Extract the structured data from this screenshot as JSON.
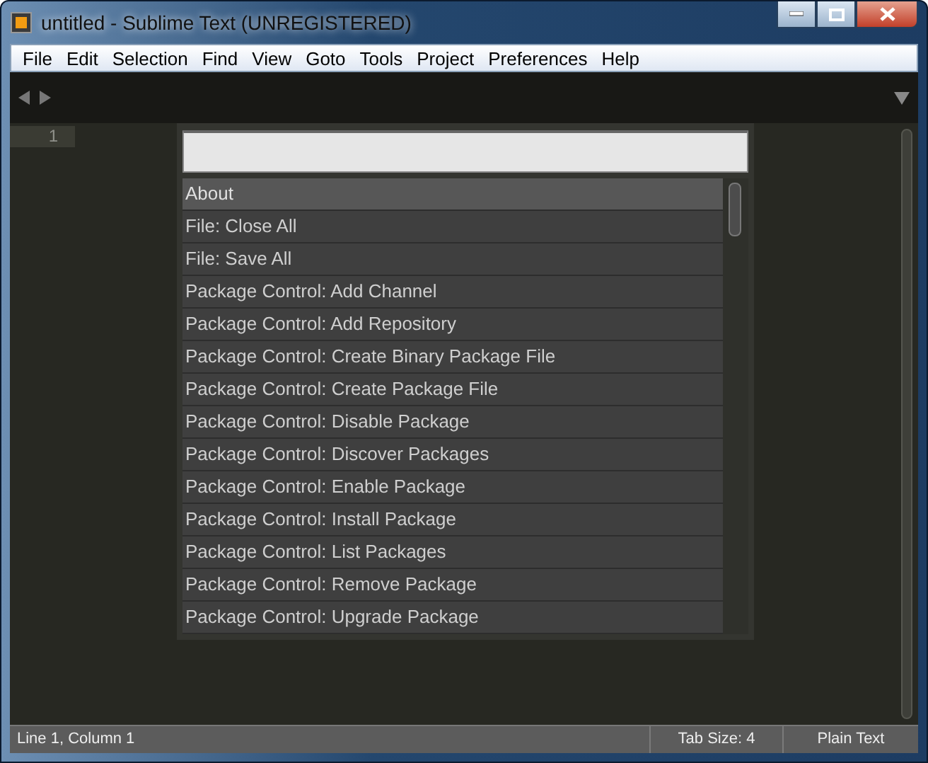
{
  "window": {
    "title": "untitled - Sublime Text (UNREGISTERED)"
  },
  "menu": [
    "File",
    "Edit",
    "Selection",
    "Find",
    "View",
    "Goto",
    "Tools",
    "Project",
    "Preferences",
    "Help"
  ],
  "editor": {
    "line_numbers": [
      "1"
    ]
  },
  "palette": {
    "items": [
      {
        "label": "About",
        "selected": true
      },
      {
        "label": "File: Close All",
        "selected": false
      },
      {
        "label": "File: Save All",
        "selected": false
      },
      {
        "label": "Package Control: Add Channel",
        "selected": false
      },
      {
        "label": "Package Control: Add Repository",
        "selected": false
      },
      {
        "label": "Package Control: Create Binary Package File",
        "selected": false
      },
      {
        "label": "Package Control: Create Package File",
        "selected": false
      },
      {
        "label": "Package Control: Disable Package",
        "selected": false
      },
      {
        "label": "Package Control: Discover Packages",
        "selected": false
      },
      {
        "label": "Package Control: Enable Package",
        "selected": false
      },
      {
        "label": "Package Control: Install Package",
        "selected": false
      },
      {
        "label": "Package Control: List Packages",
        "selected": false
      },
      {
        "label": "Package Control: Remove Package",
        "selected": false
      },
      {
        "label": "Package Control: Upgrade Package",
        "selected": false
      }
    ]
  },
  "status_bar": {
    "position": "Line 1, Column 1",
    "tab_size": "Tab Size: 4",
    "syntax": "Plain Text"
  }
}
